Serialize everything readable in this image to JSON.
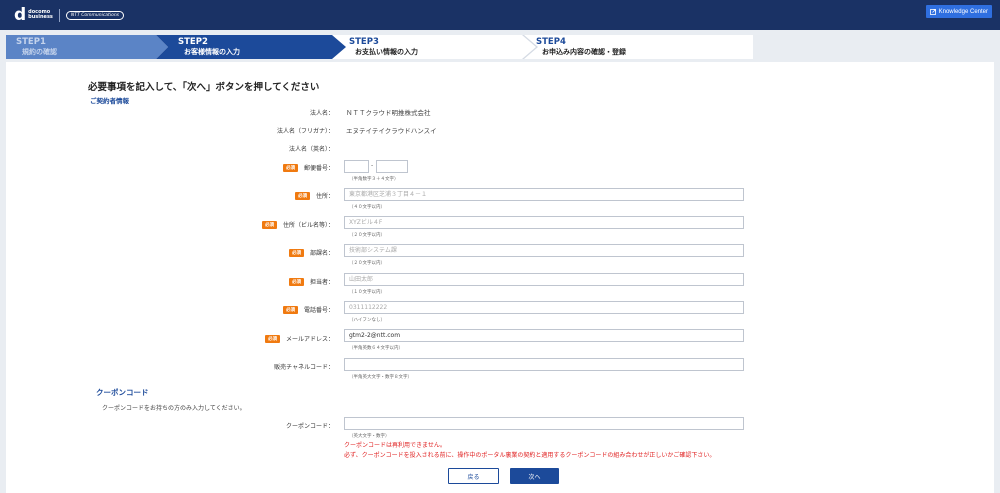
{
  "header": {
    "logo_mark": "d",
    "logo_line1": "docomo",
    "logo_line2": "business",
    "partner_logo": "NTT Communications",
    "knowledge_center": "Knowledge Center"
  },
  "steps": [
    {
      "title": "STEP1",
      "subtitle": "規約の確認",
      "state": "done"
    },
    {
      "title": "STEP2",
      "subtitle": "お客様情報の入力",
      "state": "active"
    },
    {
      "title": "STEP3",
      "subtitle": "お支払い情報の入力",
      "state": "todo"
    },
    {
      "title": "STEP4",
      "subtitle": "お申込み内容の確認・登録",
      "state": "todo"
    }
  ],
  "form": {
    "heading": "必要事項を記入して、「次へ」ボタンを押してください",
    "section_contract": "ご契約者情報",
    "required_badge": "必須",
    "corp_name": {
      "label": "法人名：",
      "value": "ＮＴＴクラウド明推株式会社"
    },
    "corp_kana": {
      "label": "法人名（フリガナ）：",
      "value": "エヌテイテイクラウドハンスイ"
    },
    "corp_en": {
      "label": "法人名（英名）：",
      "value": ""
    },
    "postal": {
      "label": "郵便番号：",
      "value1": "",
      "value2": "",
      "separator": "-",
      "hint": "（半角数字３＋４文字）"
    },
    "address": {
      "label": "住所：",
      "placeholder": "東京都港区芝浦３丁目４－１",
      "hint": "（４０文字以内）"
    },
    "building": {
      "label": "住所（ビル名等）：",
      "placeholder": "XYZビル４F",
      "hint": "（２０文字以内）"
    },
    "department": {
      "label": "部課名：",
      "placeholder": "技術部システム課",
      "hint": "（２０文字以内）"
    },
    "person": {
      "label": "担当者：",
      "placeholder": "山田太郎",
      "hint": "（１０文字以内）"
    },
    "phone": {
      "label": "電話番号：",
      "placeholder": "0311112222",
      "hint": "（ハイフンなし）"
    },
    "email": {
      "label": "メールアドレス：",
      "value": "gtm2-2@ntt.com",
      "hint": "（半角英数６４文字以内）"
    },
    "channel": {
      "label": "販売チャネルコード：",
      "value": "",
      "hint": "（半角英大文字・数字８文字）"
    }
  },
  "coupon": {
    "heading": "クーポンコード",
    "description": "クーポンコードをお持ちの方のみ入力してください。",
    "label": "クーポンコード：",
    "value": "",
    "hint": "（英大文字・数字）",
    "error1": "クーポンコードは再利用できません。",
    "error2": "必ず、クーポンコードを投入される前に、操作中のポータル裏業の契約と適用するクーポンコードの組み合わせが正しいかご確認下さい。"
  },
  "buttons": {
    "back": "戻る",
    "next": "次へ"
  },
  "colors": {
    "navy": "#1a3265",
    "accent": "#1c4a9a",
    "required": "#f07a10",
    "error": "#e02020"
  }
}
